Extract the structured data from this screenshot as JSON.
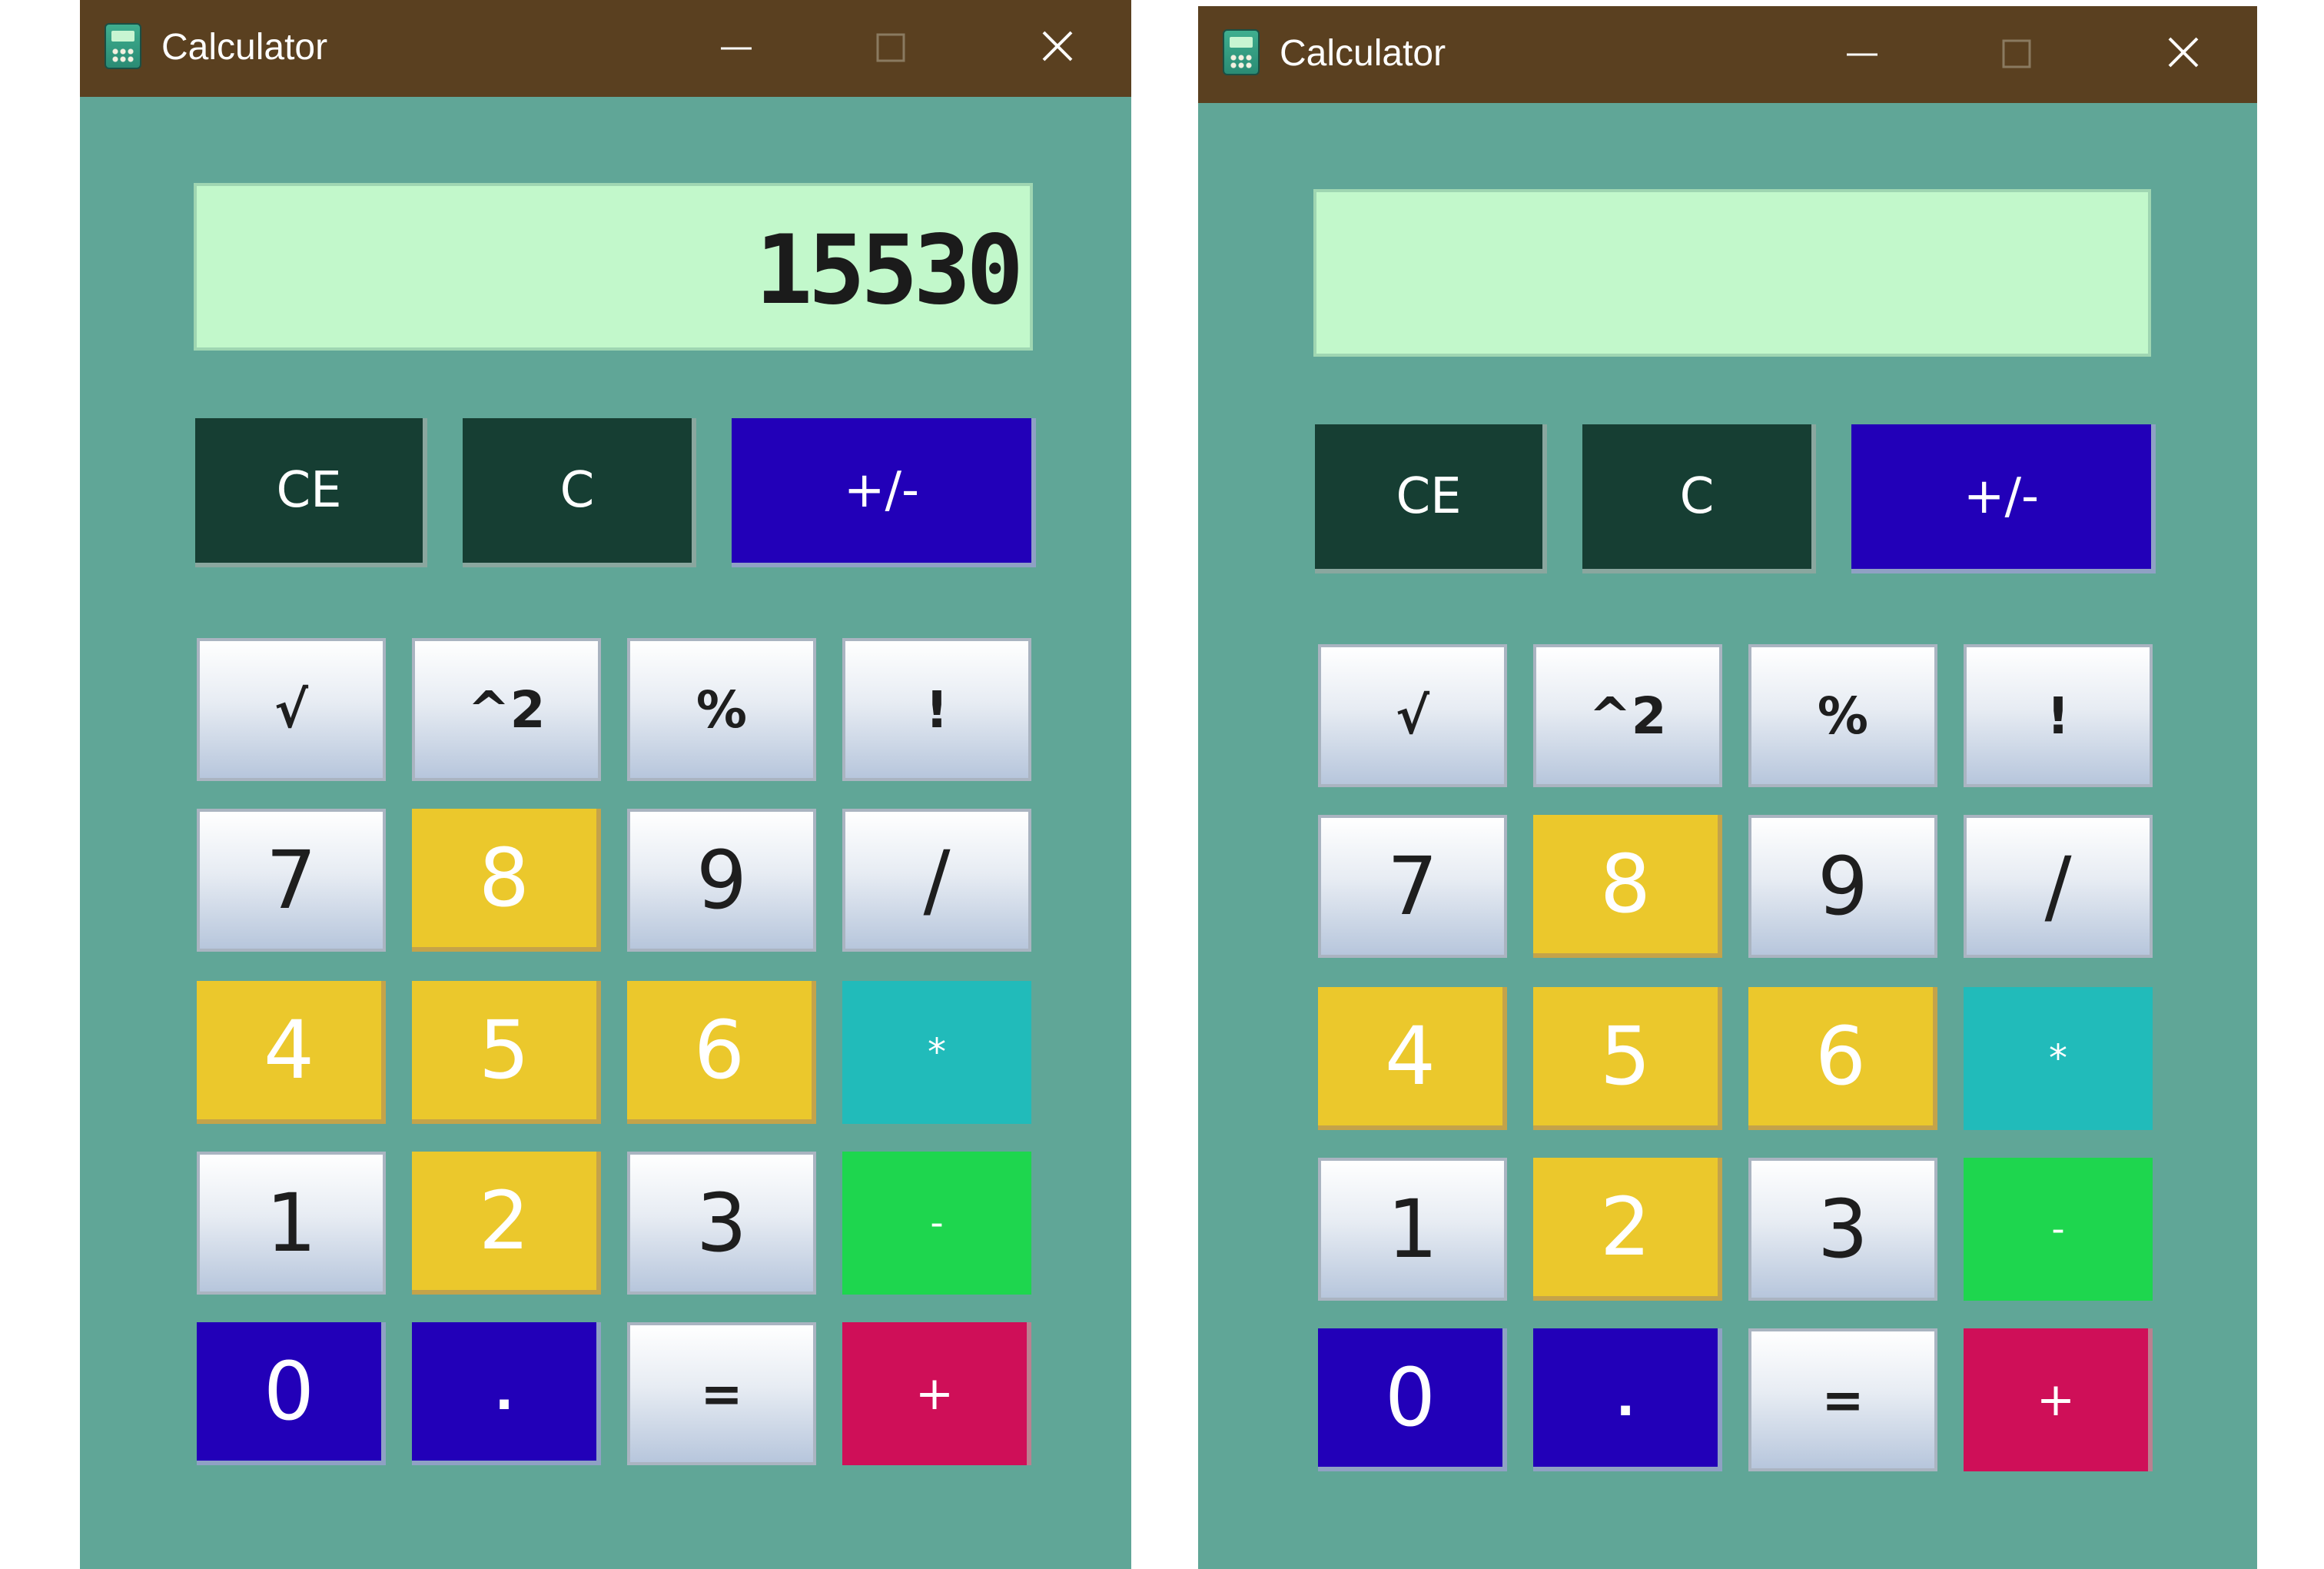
{
  "windows": [
    {
      "title": "Calculator",
      "display": "15530",
      "controls": {
        "minimize": "—",
        "maximize": "☐",
        "close": "✕"
      }
    },
    {
      "title": "Calculator",
      "display": "",
      "controls": {
        "minimize": "—",
        "maximize": "☐",
        "close": "✕"
      }
    }
  ],
  "top_row": [
    "CE",
    "C",
    "+/-"
  ],
  "keys": [
    [
      "√",
      "^2",
      "%",
      "!"
    ],
    [
      "7",
      "8",
      "9",
      "/"
    ],
    [
      "4",
      "5",
      "6",
      "*"
    ],
    [
      "1",
      "2",
      "3",
      "-"
    ],
    [
      "0",
      ".",
      "=",
      "+"
    ]
  ],
  "colors": {
    "title_bar": "#5a4020",
    "window_bg": "#60a697",
    "display_bg": "#c2f8cb",
    "dark_button": "#163e33",
    "blue_button": "#2200b8",
    "yellow_button": "#ebc82c",
    "teal_button": "#21bbba",
    "green_button": "#1ed64e",
    "red_button": "#cf0f58"
  },
  "icons": [
    "calculator-app-icon",
    "minimize-icon",
    "maximize-icon",
    "close-icon"
  ]
}
